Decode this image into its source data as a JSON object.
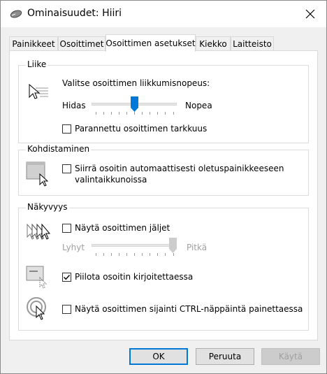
{
  "window": {
    "title": "Ominaisuudet: Hiiri",
    "close_symbol": "✕"
  },
  "tabs": [
    {
      "label": "Painikkeet"
    },
    {
      "label": "Osoittimet"
    },
    {
      "label": "Osoittimen asetukset",
      "active": true
    },
    {
      "label": "Kiekko"
    },
    {
      "label": "Laitteisto"
    }
  ],
  "motion": {
    "legend": "Liike",
    "speed_label": "Valitse osoittimen liikkumisnopeus:",
    "slow_label": "Hidas",
    "fast_label": "Nopea",
    "speed_value_fraction": 0.5,
    "precision_label": "Parannettu osoittimen tarkkuus",
    "precision_checked": false
  },
  "snap": {
    "legend": "Kohdistaminen",
    "label_line1": "Siirrä osoitin automaattisesti oletuspainikkeeseen",
    "label_line2": "valintaikkunoissa",
    "checked": false
  },
  "visibility": {
    "legend": "Näkyvyys",
    "trails_label": "Näytä osoittimen jäljet",
    "trails_checked": false,
    "short_label": "Lyhyt",
    "long_label": "Pitkä",
    "trails_value_fraction": 1.0,
    "hide_label": "Piilota osoitin kirjoitettaessa",
    "hide_checked": true,
    "ctrl_label": "Näytä osoittimen sijainti CTRL-näppäintä painettaessa",
    "ctrl_checked": false
  },
  "buttons": {
    "ok": "OK",
    "cancel": "Peruuta",
    "apply": "Käytä"
  },
  "colors": {
    "accent": "#0078d7"
  }
}
